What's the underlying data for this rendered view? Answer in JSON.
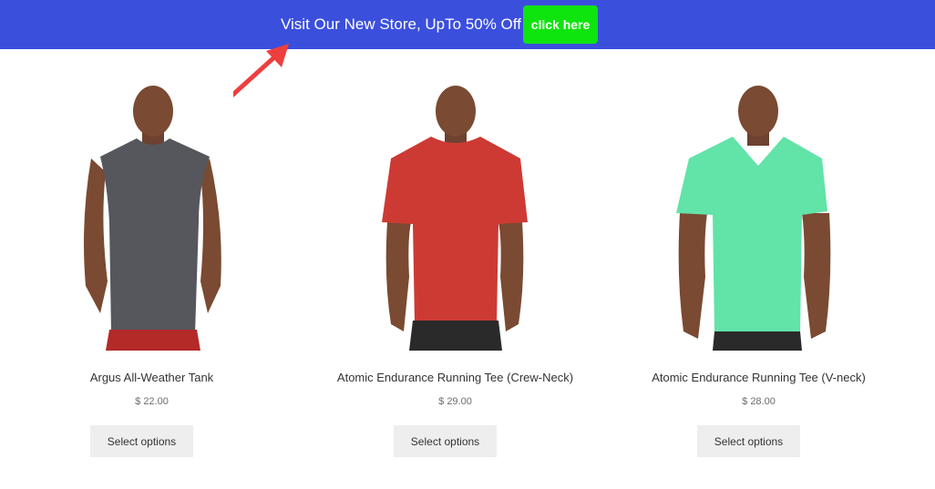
{
  "banner": {
    "text": "Visit Our New Store, UpTo 50% Off",
    "button_label": "click here",
    "background_color": "#3b4fdd",
    "button_color": "#0ee40e",
    "arrow_color": "#ef3e3e"
  },
  "products": [
    {
      "name": "Argus All-Weather Tank",
      "price": "$ 22.00",
      "button_label": "Select options",
      "shirt_color": "#55575d",
      "shorts_color": "#b32a28"
    },
    {
      "name": "Atomic Endurance Running Tee (Crew-Neck)",
      "price": "$ 29.00",
      "button_label": "Select options",
      "shirt_color": "#cd3a34",
      "shorts_color": "#2a2a2a"
    },
    {
      "name": "Atomic Endurance Running Tee (V-neck)",
      "price": "$ 28.00",
      "button_label": "Select options",
      "shirt_color": "#62e3a8",
      "shorts_color": "#2a2a2a"
    }
  ]
}
